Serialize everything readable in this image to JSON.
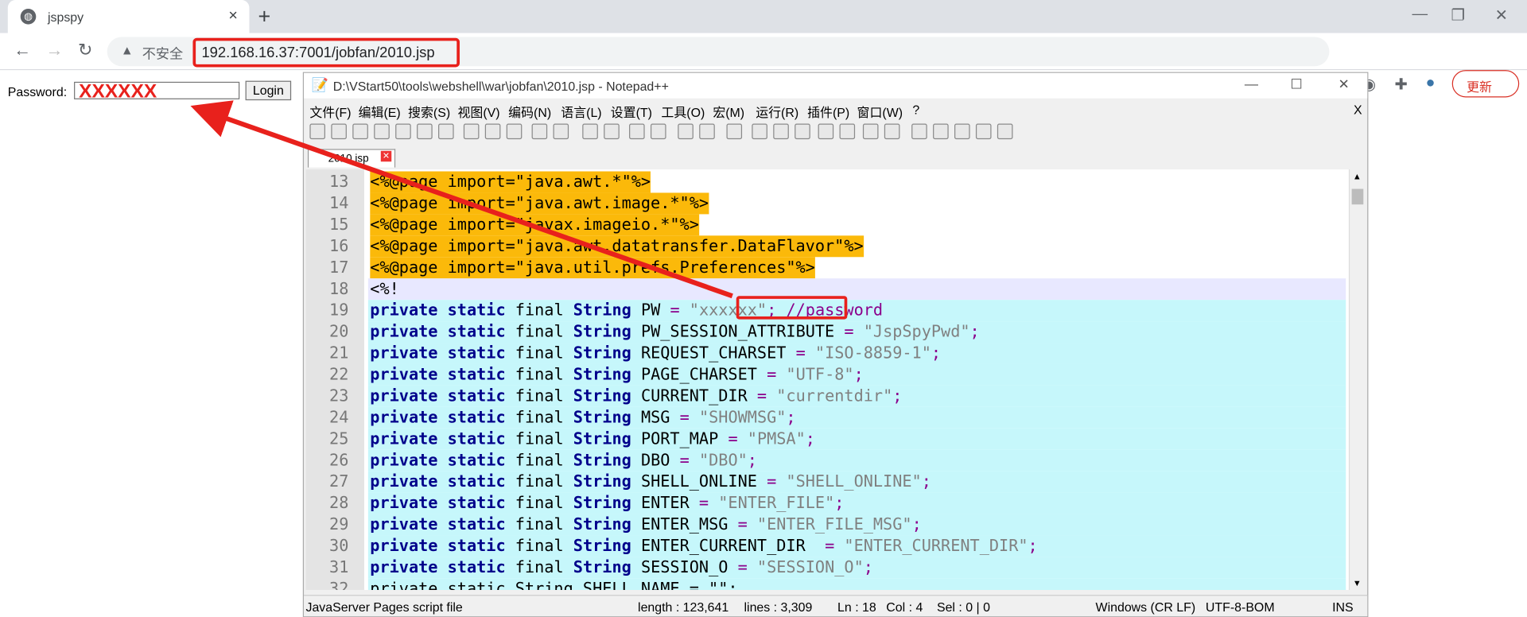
{
  "browser": {
    "tab_title": "jspspy",
    "tab_close": "×",
    "new_tab": "+",
    "insecure_label": "不安全",
    "url": "192.168.16.37:7001/jobfan/2010.jsp",
    "update_label": "更新"
  },
  "page": {
    "password_label": "Password:",
    "password_value": "XXXXXX",
    "login_label": "Login"
  },
  "notepad": {
    "title": "D:\\VStart50\\tools\\webshell\\war\\jobfan\\2010.jsp - Notepad++",
    "menu": [
      "文件(F)",
      "编辑(E)",
      "搜索(S)",
      "视图(V)",
      "编码(N)",
      "语言(L)",
      "设置(T)",
      "工具(O)",
      "宏(M)",
      "运行(R)",
      "插件(P)",
      "窗口(W)",
      "?"
    ],
    "menu_close": "X",
    "doc_tab": "2010.jsp",
    "status": {
      "file_type": "JavaServer Pages script file",
      "length": "length : 123,641",
      "lines": "lines : 3,309",
      "ln": "Ln : 18",
      "col": "Col : 4",
      "sel": "Sel : 0 | 0",
      "eol": "Windows (CR LF)",
      "encoding": "UTF-8-BOM",
      "mode": "INS"
    }
  },
  "code_lines": [
    {
      "n": "13",
      "text": "<%@page import=\"java.awt.*\"%>"
    },
    {
      "n": "14",
      "text": "<%@page import=\"java.awt.image.*\"%>"
    },
    {
      "n": "15",
      "text": "<%@page import=\"javax.imageio.*\"%>"
    },
    {
      "n": "16",
      "text": "<%@page import=\"java.awt.datatransfer.DataFlavor\"%>"
    },
    {
      "n": "17",
      "text": "<%@page import=\"java.util.prefs.Preferences\"%>"
    },
    {
      "n": "18",
      "text": "<%!"
    },
    {
      "n": "19",
      "name": "PW",
      "value": "\"xxxxxx\"",
      "comment": "//password"
    },
    {
      "n": "20",
      "name": "PW_SESSION_ATTRIBUTE",
      "value": "\"JspSpyPwd\""
    },
    {
      "n": "21",
      "name": "REQUEST_CHARSET",
      "value": "\"ISO-8859-1\""
    },
    {
      "n": "22",
      "name": "PAGE_CHARSET",
      "value": "\"UTF-8\""
    },
    {
      "n": "23",
      "name": "CURRENT_DIR",
      "value": "\"currentdir\""
    },
    {
      "n": "24",
      "name": "MSG",
      "value": "\"SHOWMSG\""
    },
    {
      "n": "25",
      "name": "PORT_MAP",
      "value": "\"PMSA\""
    },
    {
      "n": "26",
      "name": "DBO",
      "value": "\"DBO\""
    },
    {
      "n": "27",
      "name": "SHELL_ONLINE",
      "value": "\"SHELL_ONLINE\""
    },
    {
      "n": "28",
      "name": "ENTER",
      "value": "\"ENTER_FILE\""
    },
    {
      "n": "29",
      "name": "ENTER_MSG",
      "value": "\"ENTER_FILE_MSG\""
    },
    {
      "n": "30",
      "name": "ENTER_CURRENT_DIR ",
      "value": "\"ENTER_CURRENT_DIR\""
    },
    {
      "n": "31",
      "name": "SESSION_O",
      "value": "\"SESSION_O\""
    },
    {
      "n": "32",
      "text": "private static String SHELL_NAME = \"\";"
    }
  ],
  "code_keywords": {
    "private": "private",
    "static": "static",
    "final": "final",
    "type": "String",
    "eq": "=",
    "semi": ";"
  },
  "colors": {
    "annotation": "#e8211c",
    "import_highlight": "#fbb90a",
    "block_highlight": "#c6f7fb",
    "keyword": "#00008b"
  }
}
